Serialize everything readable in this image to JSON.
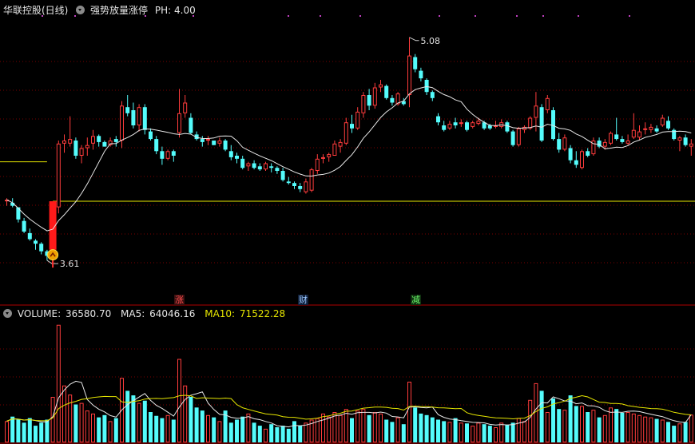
{
  "header": {
    "title": "华联控股(日线)",
    "indicator_name": "强势放量涨停",
    "param_label": "PH:",
    "param_value": "4.00"
  },
  "volume_header": {
    "label": "VOLUME:",
    "value": "36580.70",
    "ma5_label": "MA5:",
    "ma5_value": "64046.16",
    "ma10_label": "MA10:",
    "ma10_value": "71522.28"
  },
  "events": [
    {
      "label": "涨",
      "color": "#ff4d4d",
      "bg": "#3a1010"
    },
    {
      "label": "财",
      "color": "#9cc8ff",
      "bg": "#10203a"
    },
    {
      "label": "减",
      "color": "#6dff6d",
      "bg": "#0f2f0f"
    }
  ],
  "colors": {
    "up": "#ff3c3c",
    "down": "#54fcfc",
    "ma": "#e8e8e8",
    "ma10": "#e6e600",
    "grid": "#7a0000",
    "limit_bar": "#ff1a1a"
  },
  "chart_data": {
    "type": "candlestick",
    "price_axis": {
      "min": 3.4,
      "max": 5.2
    },
    "annotations": [
      {
        "text": "5.08",
        "kind": "high",
        "value": 5.08
      },
      {
        "text": "3.61",
        "kind": "low",
        "value": 3.61
      }
    ],
    "reference_line": 4.0,
    "short_reference_line": 4.26,
    "ohlc": [
      [
        4.0,
        4.02,
        3.97,
        4.01
      ],
      [
        3.99,
        4.02,
        3.96,
        3.97
      ],
      [
        3.96,
        3.96,
        3.86,
        3.88
      ],
      [
        3.87,
        3.89,
        3.79,
        3.8
      ],
      [
        3.79,
        3.82,
        3.74,
        3.75
      ],
      [
        3.74,
        3.75,
        3.68,
        3.72
      ],
      [
        3.72,
        3.73,
        3.65,
        3.67
      ],
      [
        3.67,
        3.68,
        3.61,
        3.64
      ],
      [
        3.66,
        3.9,
        3.66,
        3.9
      ],
      [
        3.96,
        4.4,
        3.92,
        4.38
      ],
      [
        4.38,
        4.44,
        4.32,
        4.4
      ],
      [
        4.38,
        4.56,
        4.36,
        4.41
      ],
      [
        4.4,
        4.42,
        4.28,
        4.3
      ],
      [
        4.3,
        4.37,
        4.25,
        4.35
      ],
      [
        4.35,
        4.42,
        4.3,
        4.37
      ],
      [
        4.38,
        4.47,
        4.34,
        4.43
      ],
      [
        4.43,
        4.44,
        4.36,
        4.39
      ],
      [
        4.39,
        4.4,
        4.36,
        4.36
      ],
      [
        4.37,
        4.42,
        4.36,
        4.4
      ],
      [
        4.41,
        4.43,
        4.36,
        4.39
      ],
      [
        4.4,
        4.66,
        4.35,
        4.63
      ],
      [
        4.62,
        4.7,
        4.56,
        4.58
      ],
      [
        4.6,
        4.65,
        4.48,
        4.5
      ],
      [
        4.5,
        4.64,
        4.46,
        4.62
      ],
      [
        4.62,
        4.64,
        4.44,
        4.47
      ],
      [
        4.46,
        4.48,
        4.4,
        4.41
      ],
      [
        4.41,
        4.43,
        4.31,
        4.33
      ],
      [
        4.33,
        4.36,
        4.24,
        4.28
      ],
      [
        4.28,
        4.34,
        4.27,
        4.33
      ],
      [
        4.33,
        4.34,
        4.26,
        4.3
      ],
      [
        4.45,
        4.74,
        4.42,
        4.58
      ],
      [
        4.58,
        4.7,
        4.55,
        4.65
      ],
      [
        4.55,
        4.58,
        4.44,
        4.45
      ],
      [
        4.44,
        4.46,
        4.4,
        4.41
      ],
      [
        4.41,
        4.43,
        4.36,
        4.39
      ],
      [
        4.4,
        4.43,
        4.37,
        4.41
      ],
      [
        4.4,
        4.4,
        4.37,
        4.37
      ],
      [
        4.38,
        4.42,
        4.36,
        4.4
      ],
      [
        4.4,
        4.41,
        4.33,
        4.34
      ],
      [
        4.33,
        4.37,
        4.27,
        4.29
      ],
      [
        4.3,
        4.32,
        4.25,
        4.28
      ],
      [
        4.28,
        4.3,
        4.21,
        4.22
      ],
      [
        4.23,
        4.26,
        4.2,
        4.25
      ],
      [
        4.25,
        4.27,
        4.21,
        4.22
      ],
      [
        4.23,
        4.25,
        4.2,
        4.21
      ],
      [
        4.21,
        4.26,
        4.2,
        4.25
      ],
      [
        4.23,
        4.25,
        4.19,
        4.22
      ],
      [
        4.22,
        4.23,
        4.18,
        4.2
      ],
      [
        4.2,
        4.22,
        4.13,
        4.14
      ],
      [
        4.13,
        4.16,
        4.11,
        4.12
      ],
      [
        4.12,
        4.13,
        4.08,
        4.1
      ],
      [
        4.1,
        4.12,
        4.06,
        4.08
      ],
      [
        4.06,
        4.15,
        4.05,
        4.13
      ],
      [
        4.07,
        4.22,
        4.06,
        4.21
      ],
      [
        4.2,
        4.31,
        4.18,
        4.28
      ],
      [
        4.28,
        4.31,
        4.25,
        4.29
      ],
      [
        4.29,
        4.32,
        4.26,
        4.31
      ],
      [
        4.3,
        4.4,
        4.3,
        4.38
      ],
      [
        4.36,
        4.41,
        4.32,
        4.39
      ],
      [
        4.38,
        4.55,
        4.37,
        4.52
      ],
      [
        4.51,
        4.57,
        4.45,
        4.48
      ],
      [
        4.48,
        4.62,
        4.47,
        4.59
      ],
      [
        4.58,
        4.72,
        4.55,
        4.7
      ],
      [
        4.7,
        4.74,
        4.6,
        4.63
      ],
      [
        4.63,
        4.78,
        4.61,
        4.75
      ],
      [
        4.75,
        4.8,
        4.72,
        4.77
      ],
      [
        4.76,
        4.77,
        4.67,
        4.68
      ],
      [
        4.68,
        4.7,
        4.63,
        4.65
      ],
      [
        4.64,
        4.72,
        4.63,
        4.71
      ],
      [
        4.66,
        4.68,
        4.63,
        4.64
      ],
      [
        4.7,
        5.08,
        4.62,
        4.96
      ],
      [
        4.95,
        4.97,
        4.85,
        4.87
      ],
      [
        4.86,
        4.88,
        4.79,
        4.81
      ],
      [
        4.8,
        4.81,
        4.7,
        4.72
      ],
      [
        4.72,
        4.73,
        4.66,
        4.68
      ],
      [
        4.56,
        4.58,
        4.5,
        4.52
      ],
      [
        4.5,
        4.53,
        4.46,
        4.47
      ],
      [
        4.48,
        4.53,
        4.47,
        4.51
      ],
      [
        4.52,
        4.55,
        4.48,
        4.5
      ],
      [
        4.51,
        4.54,
        4.49,
        4.52
      ],
      [
        4.52,
        4.53,
        4.46,
        4.47
      ],
      [
        4.49,
        4.53,
        4.48,
        4.52
      ],
      [
        4.51,
        4.55,
        4.5,
        4.53
      ],
      [
        4.52,
        4.53,
        4.47,
        4.48
      ],
      [
        4.5,
        4.51,
        4.47,
        4.48
      ],
      [
        4.49,
        4.53,
        4.48,
        4.5
      ],
      [
        4.49,
        4.54,
        4.48,
        4.52
      ],
      [
        4.52,
        4.53,
        4.45,
        4.46
      ],
      [
        4.46,
        4.47,
        4.36,
        4.37
      ],
      [
        4.37,
        4.49,
        4.36,
        4.48
      ],
      [
        4.47,
        4.5,
        4.45,
        4.49
      ],
      [
        4.48,
        4.56,
        4.47,
        4.55
      ],
      [
        4.55,
        4.72,
        4.46,
        4.63
      ],
      [
        4.62,
        4.64,
        4.39,
        4.4
      ],
      [
        4.6,
        4.7,
        4.58,
        4.68
      ],
      [
        4.6,
        4.62,
        4.4,
        4.41
      ],
      [
        4.41,
        4.45,
        4.32,
        4.34
      ],
      [
        4.34,
        4.44,
        4.33,
        4.42
      ],
      [
        4.35,
        4.37,
        4.25,
        4.27
      ],
      [
        4.27,
        4.33,
        4.22,
        4.24
      ],
      [
        4.22,
        4.34,
        4.21,
        4.33
      ],
      [
        4.33,
        4.35,
        4.29,
        4.3
      ],
      [
        4.31,
        4.42,
        4.3,
        4.4
      ],
      [
        4.4,
        4.42,
        4.35,
        4.36
      ],
      [
        4.36,
        4.41,
        4.34,
        4.39
      ],
      [
        4.38,
        4.46,
        4.37,
        4.45
      ],
      [
        4.44,
        4.55,
        4.4,
        4.41
      ],
      [
        4.41,
        4.43,
        4.38,
        4.39
      ],
      [
        4.38,
        4.44,
        4.37,
        4.4
      ],
      [
        4.42,
        4.58,
        4.41,
        4.47
      ],
      [
        4.42,
        4.5,
        4.4,
        4.46
      ],
      [
        4.47,
        4.52,
        4.44,
        4.48
      ],
      [
        4.47,
        4.51,
        4.45,
        4.49
      ],
      [
        4.48,
        4.5,
        4.45,
        4.46
      ],
      [
        4.5,
        4.57,
        4.49,
        4.55
      ],
      [
        4.53,
        4.56,
        4.47,
        4.48
      ],
      [
        4.47,
        4.48,
        4.4,
        4.41
      ],
      [
        4.4,
        4.43,
        4.33,
        4.42
      ],
      [
        4.42,
        4.44,
        4.36,
        4.37
      ],
      [
        4.36,
        4.41,
        4.3,
        4.38
      ]
    ],
    "volume_axis": {
      "min": 0,
      "max": 160000
    },
    "volume": [
      28000,
      34000,
      30000,
      26000,
      32000,
      22000,
      26000,
      30000,
      60000,
      155000,
      75000,
      63000,
      50000,
      52000,
      42000,
      38000,
      33000,
      36000,
      28000,
      32000,
      85000,
      68000,
      62000,
      52000,
      55000,
      40000,
      35000,
      32000,
      36000,
      30000,
      110000,
      75000,
      60000,
      46000,
      42000,
      36000,
      33000,
      28000,
      42000,
      26000,
      30000,
      34000,
      38000,
      26000,
      22000,
      18000,
      24000,
      20000,
      22000,
      18000,
      28000,
      22000,
      26000,
      30000,
      32000,
      38000,
      34000,
      40000,
      36000,
      44000,
      32000,
      42000,
      44000,
      36000,
      40000,
      38000,
      30000,
      27000,
      33000,
      24000,
      80000,
      46000,
      38000,
      36000,
      33000,
      30000,
      28000,
      27000,
      32000,
      26000,
      25000,
      22000,
      26000,
      24000,
      22000,
      20000,
      26000,
      23000,
      26000,
      32000,
      28000,
      56000,
      78000,
      68000,
      40000,
      58000,
      44000,
      43000,
      62000,
      48000,
      48000,
      40000,
      43000,
      33000,
      36000,
      46000,
      44000,
      39000,
      40000,
      38000,
      36000,
      34000,
      33000,
      31000,
      30000,
      27000,
      22000,
      25000,
      27000,
      36580
    ],
    "ma5_volume": [
      28000,
      31000,
      30667,
      29500,
      30000,
      28800,
      27200,
      27200,
      34000,
      58600,
      69200,
      76600,
      80600,
      79000,
      56400,
      49000,
      43800,
      40200,
      35400,
      33400,
      42800,
      49800,
      55000,
      59800,
      64400,
      55400,
      48800,
      44800,
      39800,
      34600,
      46600,
      56600,
      62200,
      64200,
      66600,
      51800,
      43400,
      37000,
      36200,
      33000,
      31800,
      32000,
      34000,
      31200,
      30000,
      27600,
      25600,
      22000,
      21200,
      20400,
      22400,
      22000,
      22800,
      24800,
      27600,
      29600,
      32000,
      34800,
      36000,
      38400,
      37200,
      39200,
      39600,
      39600,
      38800,
      40000,
      38600,
      34200,
      33600,
      32400,
      46600,
      46800,
      46000,
      45600,
      46600,
      36600,
      33000,
      30800,
      30000,
      28600,
      27600,
      26400,
      26200,
      25800,
      23800,
      22800,
      23600,
      23000,
      23400,
      25400,
      27000,
      33000,
      44000,
      52400,
      52000,
      60000,
      57600,
      54600,
      54400,
      51000,
      52000,
      48400,
      48200,
      46200,
      41800,
      39600,
      40000,
      39600,
      41000,
      41400,
      40600,
      38800,
      37200,
      35600,
      34000,
      31000,
      28600,
      27000,
      26200,
      36580
    ],
    "ma10_volume": [
      28000,
      31000,
      30667,
      29500,
      30000,
      29000,
      28571,
      28750,
      32222,
      44500,
      49200,
      52100,
      54100,
      56700,
      57700,
      59300,
      60000,
      60600,
      60400,
      60400,
      53400,
      52700,
      53900,
      54900,
      57200,
      57800,
      58000,
      57600,
      58400,
      59000,
      61500,
      62100,
      61300,
      57900,
      58800,
      58400,
      58200,
      57800,
      58400,
      57800,
      49800,
      45700,
      43500,
      41500,
      39500,
      37700,
      36800,
      36000,
      34000,
      33200,
      33000,
      31800,
      30600,
      31000,
      32000,
      34000,
      35000,
      37000,
      38400,
      41000,
      41400,
      43400,
      45200,
      45800,
      46600,
      46600,
      46200,
      44900,
      44600,
      42600,
      47400,
      47800,
      47200,
      47200,
      46500,
      45700,
      45500,
      44900,
      44500,
      44700,
      39200,
      36800,
      35600,
      34400,
      33300,
      32300,
      32100,
      31700,
      31100,
      31700,
      32000,
      35400,
      40600,
      45000,
      46800,
      50600,
      52400,
      54400,
      58000,
      59600,
      61600,
      60000,
      56500,
      53000,
      52600,
      51400,
      51400,
      50600,
      48400,
      47400,
      46200,
      45600,
      44600,
      44400,
      43800,
      41900,
      39700,
      38300,
      37000,
      36300
    ]
  }
}
